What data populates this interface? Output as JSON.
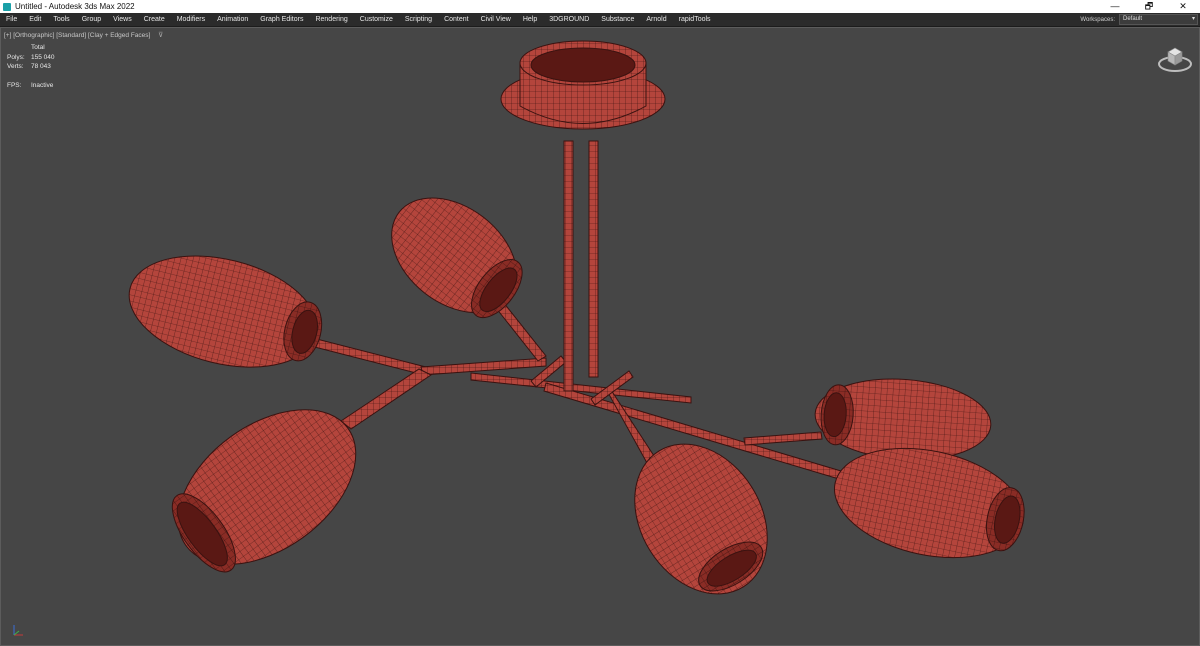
{
  "window": {
    "title": "Untitled - Autodesk 3ds Max 2022",
    "controls": [
      "—",
      "🗗",
      "✕"
    ]
  },
  "menu": {
    "items": [
      "File",
      "Edit",
      "Tools",
      "Group",
      "Views",
      "Create",
      "Modifiers",
      "Animation",
      "Graph Editors",
      "Rendering",
      "Customize",
      "Scripting",
      "Content",
      "Civil View",
      "Help",
      "3DGROUND",
      "Substance",
      "Arnold",
      "rapidTools"
    ],
    "workspaces_label": "Workspaces:",
    "workspaces_value": "Default"
  },
  "viewport": {
    "label": "[+] [Orthographic] [Standard] [Clay + Edged Faces]",
    "stats": {
      "header": "Total",
      "polys_label": "Polys:",
      "polys_value": "155 040",
      "verts_label": "Verts:",
      "verts_value": "78 043",
      "fps_label": "FPS:",
      "fps_value": "Inactive"
    }
  },
  "colors": {
    "model": "#b4453c",
    "model_dark": "#7a231e",
    "wire": "#3a1210",
    "background": "#464646"
  },
  "icons": [
    "app-icon",
    "filter-icon",
    "viewcube-icon",
    "axis-tripod-icon"
  ]
}
